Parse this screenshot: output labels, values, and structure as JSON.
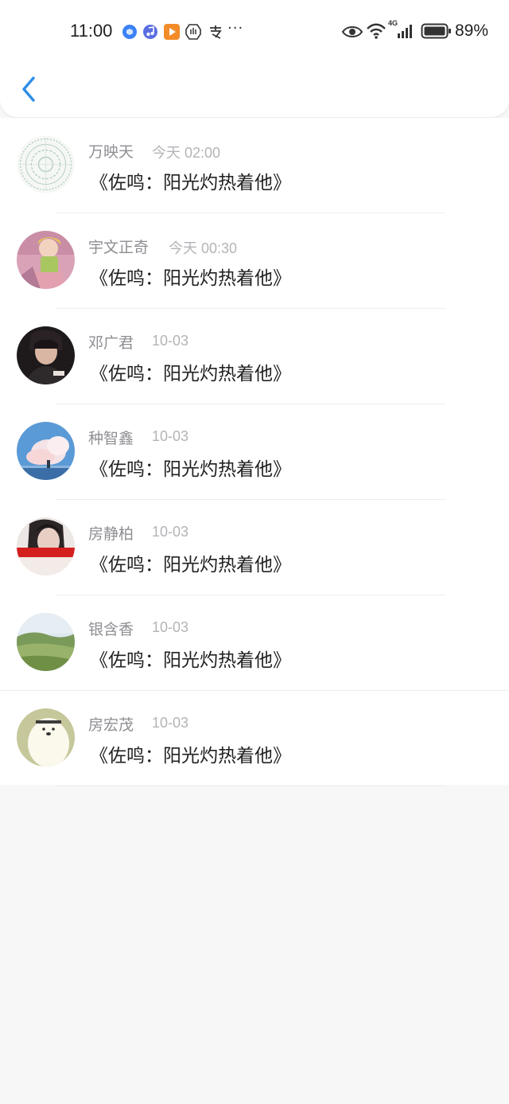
{
  "status_bar": {
    "time": "11:00",
    "more": "···",
    "network": "4G",
    "battery": "89%"
  },
  "header": {
    "back_icon": "chevron-left-icon"
  },
  "list": [
    {
      "name": "万映天",
      "time": "今天 02:00",
      "title": "《佐鸣：阳光灼热着他》",
      "avatar": "seal-pattern"
    },
    {
      "name": "宇文正奇",
      "time": "今天 00:30",
      "title": "《佐鸣：阳光灼热着他》",
      "avatar": "anime-girl"
    },
    {
      "name": "邓广君",
      "time": "10-03",
      "title": "《佐鸣：阳光灼热着他》",
      "avatar": "person-dark"
    },
    {
      "name": "种智鑫",
      "time": "10-03",
      "title": "《佐鸣：阳光灼热着他》",
      "avatar": "sky-clouds"
    },
    {
      "name": "房静柏",
      "time": "10-03",
      "title": "《佐鸣：阳光灼热着他》",
      "avatar": "woman-red-band"
    },
    {
      "name": "银含香",
      "time": "10-03",
      "title": "《佐鸣：阳光灼热着他》",
      "avatar": "green-hills"
    },
    {
      "name": "房宏茂",
      "time": "10-03",
      "title": "《佐鸣：阳光灼热着他》",
      "avatar": "polar-bear"
    }
  ],
  "colors": {
    "accent": "#2d8ee8",
    "name": "#8e8e93",
    "time": "#b4b4b8",
    "title": "#222222",
    "background": "#f8f7f8"
  }
}
